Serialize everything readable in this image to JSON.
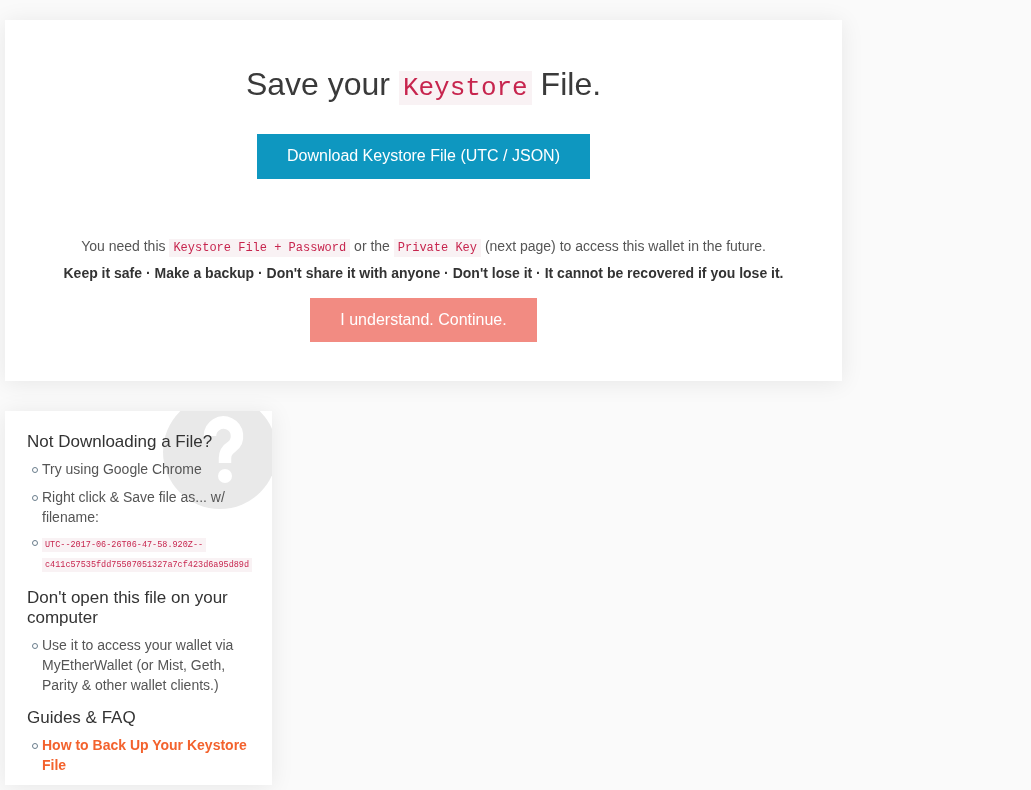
{
  "main_panel": {
    "title": [
      {
        "kind": "plain",
        "text": "Save your "
      },
      {
        "kind": "code",
        "text": "Keystore"
      },
      {
        "kind": "plain",
        "text": " File."
      }
    ],
    "download_button": {
      "label": "Download Keystore File (UTC / JSON)"
    },
    "notice": [
      {
        "kind": "plain",
        "text": "You need this "
      },
      {
        "kind": "code",
        "text": "Keystore File + Password"
      },
      {
        "kind": "plain",
        "text": " or the "
      },
      {
        "kind": "code",
        "text": "Private Key"
      },
      {
        "kind": "plain",
        "text": " (next page) to access this wallet in the future."
      }
    ],
    "warning": "Keep it safe · Make a backup · Don't share it with anyone · Don't lose it · It cannot be recovered if you lose it.",
    "continue_button": {
      "label": "I understand. Continue.",
      "disabled": true
    }
  },
  "help_panel": {
    "sections": [
      {
        "heading": "Not Downloading a File?",
        "items": [
          {
            "kind": "text",
            "text": "Try using Google Chrome"
          },
          {
            "kind": "text",
            "text": "Right click & Save file as... w/ filename:"
          },
          {
            "kind": "code",
            "text": "UTC--2017-06-26T06-47-58.920Z--c411c57535fdd75507051327a7cf423d6a95d89d"
          }
        ]
      },
      {
        "heading": "Don't open this file on your computer",
        "items": [
          {
            "kind": "text",
            "text": "Use it to access your wallet via MyEtherWallet (or Mist, Geth, Parity & other wallet clients.)"
          }
        ]
      },
      {
        "heading": "Guides & FAQ",
        "items": [
          {
            "kind": "link",
            "text": "How to Back Up Your Keystore File"
          }
        ]
      }
    ]
  }
}
